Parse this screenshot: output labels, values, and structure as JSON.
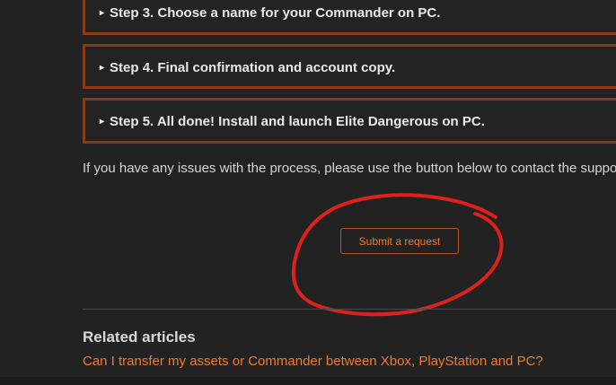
{
  "steps": [
    {
      "arrow": "▸",
      "label": "Step 3. Choose a name for your Commander on PC."
    },
    {
      "arrow": "▸",
      "label": "Step 4. Final confirmation and account copy."
    },
    {
      "arrow": "▸",
      "label": "Step 5.  All done! Install and launch Elite Dangerous on PC."
    }
  ],
  "issue_text": "If you have any issues with the process, please use the button below to contact the suppo",
  "submit_button": {
    "label": "Submit a request"
  },
  "related": {
    "title": "Related articles",
    "links": [
      "Can I transfer my assets or Commander between Xbox, PlayStation and PC?"
    ]
  },
  "colors": {
    "background": "#222222",
    "accent_border": "#8c3a12",
    "link_orange": "#f07a2c",
    "annotation_red": "#e0201a"
  },
  "annotation": {
    "type": "hand-drawn-circle",
    "target": "submit_button"
  }
}
